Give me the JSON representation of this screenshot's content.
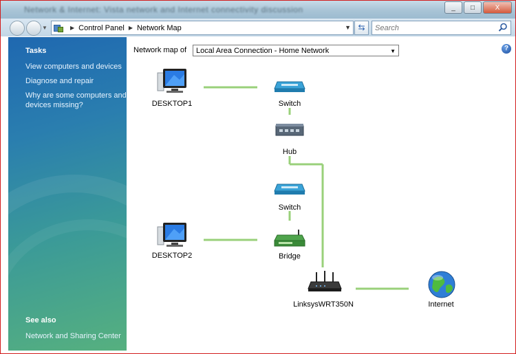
{
  "window": {
    "title": "Network & Internet: Vista network and Internet connectivity discussion",
    "buttons": [
      "_",
      "□",
      "X"
    ]
  },
  "address": {
    "breadcrumbs": [
      "Control Panel",
      "Network Map"
    ],
    "search_placeholder": "Search"
  },
  "sidebar": {
    "tasks_heading": "Tasks",
    "tasks": [
      "View computers and devices",
      "Diagnose and repair",
      "Why are some computers and devices missing?"
    ],
    "see_also_heading": "See also",
    "see_also": [
      "Network and Sharing Center"
    ]
  },
  "main": {
    "map_label": "Network map of",
    "connection_selected": "Local Area Connection - Home Network",
    "help": "?"
  },
  "devices": {
    "desktop1": "DESKTOP1",
    "switch1": "Switch",
    "hub": "Hub",
    "switch2": "Switch",
    "desktop2": "DESKTOP2",
    "bridge": "Bridge",
    "router": "LinksysWRT350N",
    "internet": "Internet"
  },
  "colors": {
    "link_line": "#99d07a",
    "sidebar_top": "#1f68b0",
    "sidebar_bottom": "#56b07f"
  }
}
